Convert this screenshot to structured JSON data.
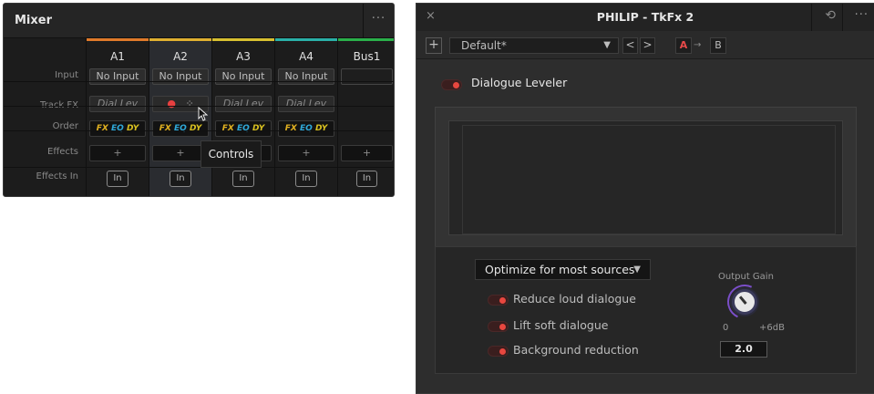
{
  "mixer": {
    "title": "Mixer",
    "more_label": "···",
    "row_labels": [
      "Input",
      "Track FX",
      "Order",
      "Effects",
      "Effects In"
    ],
    "columns": [
      {
        "name": "A1",
        "color": "#e07a2a",
        "input": "No Input",
        "track_fx": "Dial Lev"
      },
      {
        "name": "A2",
        "color": "#e0b030",
        "input": "No Input",
        "track_fx": ""
      },
      {
        "name": "A3",
        "color": "#d8c030",
        "input": "No Input",
        "track_fx": "Dial Lev"
      },
      {
        "name": "A4",
        "color": "#2ab0a8",
        "input": "No Input",
        "track_fx": "Dial Lev"
      },
      {
        "name": "Bus1",
        "color": "#2ab04a",
        "input": "",
        "track_fx": ""
      }
    ],
    "order": {
      "fx": "FX",
      "eq": "EQ",
      "dy": "DY"
    },
    "effects_add": "+",
    "effects_in": "In",
    "tooltip": "Controls"
  },
  "plugin": {
    "close": "×",
    "title": "PHILIP - TkFx 2",
    "more": "···",
    "add": "+",
    "preset": "Default*",
    "prev": "<",
    "next": ">",
    "ab_a": "A",
    "ab_arrow": "→",
    "ab_b": "B",
    "effect_name": "Dialogue Leveler",
    "mode": "Optimize for most sources",
    "options": [
      "Reduce loud dialogue",
      "Lift soft dialogue",
      "Background reduction"
    ],
    "gain": {
      "title": "Output Gain",
      "min": "0",
      "max": "+6dB",
      "value": "2.0"
    },
    "accent": "#e8473f"
  }
}
